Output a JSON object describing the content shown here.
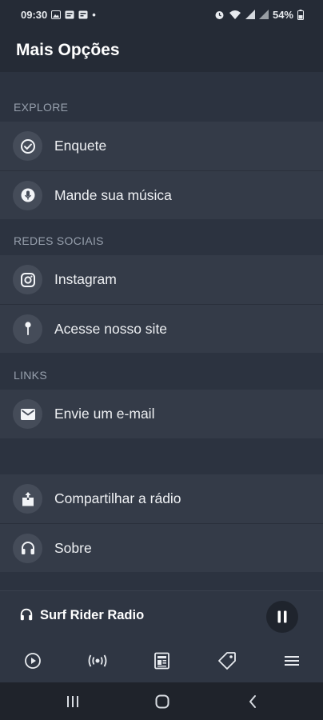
{
  "status_bar": {
    "time": "09:30",
    "dot": "•",
    "battery": "54%"
  },
  "header": {
    "title": "Mais Opções"
  },
  "sections": {
    "explore": {
      "label": "EXPLORE",
      "items": [
        {
          "label": "Enquete",
          "icon": "check-circle-icon"
        },
        {
          "label": "Mande sua música",
          "icon": "microphone-icon"
        }
      ]
    },
    "social": {
      "label": "REDES SOCIAIS",
      "items": [
        {
          "label": "Instagram",
          "icon": "instagram-icon"
        },
        {
          "label": "Acesse nosso site",
          "icon": "pin-icon"
        }
      ]
    },
    "links": {
      "label": "LINKS",
      "items": [
        {
          "label": "Envie um e-mail",
          "icon": "mail-icon"
        }
      ]
    },
    "other": {
      "items": [
        {
          "label": "Compartilhar a rádio",
          "icon": "share-icon"
        },
        {
          "label": "Sobre",
          "icon": "headphones-icon"
        }
      ]
    }
  },
  "player": {
    "station": "Surf Rider Radio",
    "state": "playing"
  },
  "bottom_nav": [
    "play-icon",
    "broadcast-icon",
    "news-icon",
    "tag-icon",
    "menu-icon"
  ],
  "colors": {
    "background": "#2c3340",
    "row": "#343b48",
    "header": "#252b36",
    "accent_text": "#ffffff"
  }
}
